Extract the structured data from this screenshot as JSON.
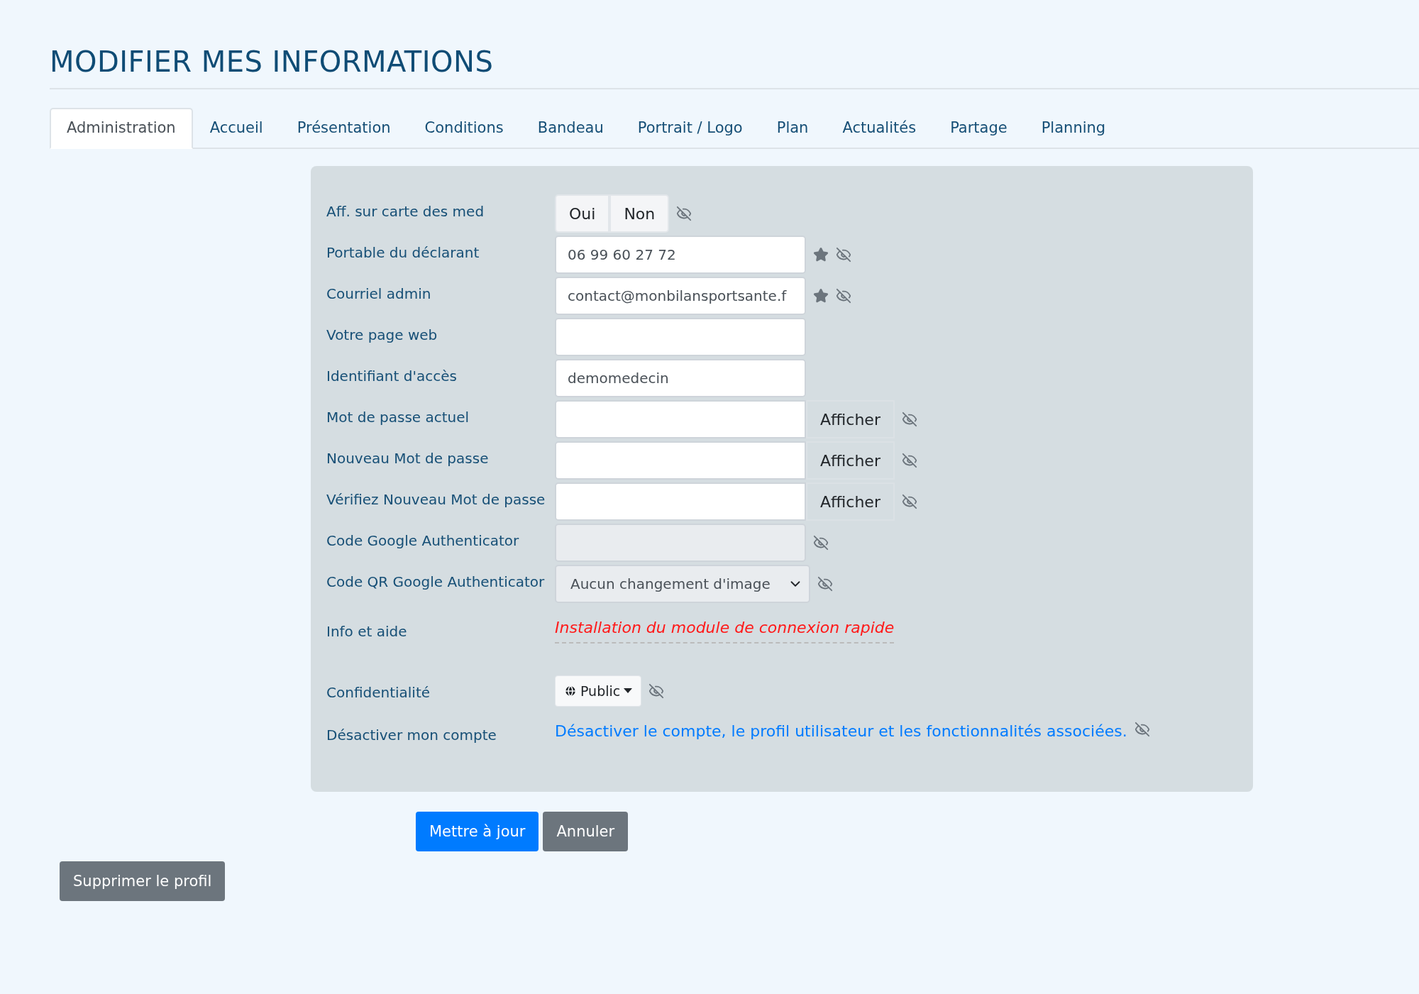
{
  "title": "MODIFIER MES INFORMATIONS",
  "tabs": [
    {
      "label": "Administration",
      "selected": true
    },
    {
      "label": "Accueil",
      "selected": false
    },
    {
      "label": "Présentation",
      "selected": false
    },
    {
      "label": "Conditions",
      "selected": false
    },
    {
      "label": "Bandeau",
      "selected": false
    },
    {
      "label": "Portrait / Logo",
      "selected": false
    },
    {
      "label": "Plan",
      "selected": false
    },
    {
      "label": "Actualités",
      "selected": false
    },
    {
      "label": "Partage",
      "selected": false
    },
    {
      "label": "Planning",
      "selected": false
    }
  ],
  "form": {
    "rows": [
      {
        "kind": "toggle",
        "label": "Aff. sur carte des med",
        "options": [
          {
            "label": "Oui",
            "selected": false
          },
          {
            "label": "Non",
            "selected": false
          }
        ]
      },
      {
        "kind": "text",
        "label": "Portable du déclarant",
        "value": "06 99 60 27 72",
        "required": true,
        "private": true
      },
      {
        "kind": "text",
        "label": "Courriel admin",
        "value": "contact@monbilansportsante.f",
        "required": true,
        "private": true
      },
      {
        "kind": "text",
        "label": "Votre page web",
        "required": false,
        "private": false
      },
      {
        "kind": "text",
        "label": "Identifiant d'accès",
        "value": "demomedecin",
        "required": false,
        "private": false
      },
      {
        "kind": "password",
        "label": "Mot de passe actuel",
        "button": "Afficher",
        "private": true
      },
      {
        "kind": "password",
        "label": "Nouveau Mot de passe",
        "button": "Afficher",
        "private": true
      },
      {
        "kind": "password",
        "label": "Vérifiez Nouveau Mot de passe",
        "button": "Afficher",
        "private": true
      },
      {
        "kind": "text",
        "label": "Code Google Authenticator",
        "disabled": true,
        "required": false,
        "private": true
      },
      {
        "kind": "select",
        "label": "Code QR Google Authenticator",
        "value": "Aucun changement d'image",
        "private": true
      },
      {
        "kind": "help",
        "label": "Info et aide",
        "link": "Installation du module de connexion rapide"
      },
      {
        "kind": "privacy",
        "label": "Confidentialité",
        "value": "Public",
        "private": true
      },
      {
        "kind": "link",
        "label": "Désactiver mon compte",
        "link": "Désactiver le compte, le profil utilisateur et les fonctionnalités associées.",
        "private": true
      }
    ]
  },
  "actions": [
    {
      "label": "Mettre à jour",
      "kind": "primary"
    },
    {
      "label": "Annuler",
      "kind": "secondary"
    }
  ],
  "delete_button": "Supprimer le profil"
}
